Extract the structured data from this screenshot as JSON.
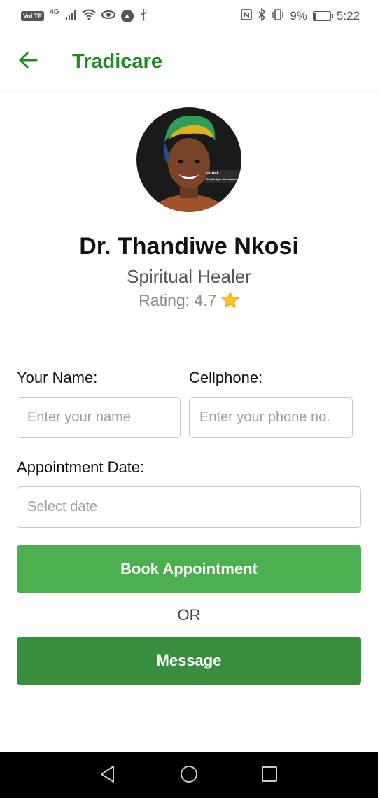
{
  "status_bar": {
    "volte": "VoLTE",
    "network": "4G",
    "battery_percent": "9%",
    "time": "5:22",
    "icons": [
      "volte-icon",
      "signal-icon",
      "wifi-icon",
      "eye-icon",
      "app-icon",
      "usb-icon",
      "nfc-icon",
      "bluetooth-icon",
      "vibrate-icon",
      "battery-icon"
    ]
  },
  "app_bar": {
    "title": "Tradicare",
    "back_icon": "arrow-left-icon",
    "accent_color": "#1f8a1f"
  },
  "profile": {
    "name": "Dr. Thandiwe Nkosi",
    "specialty": "Spiritual Healer",
    "rating_text": "Rating: 4.7",
    "rating_value": 4.7,
    "rating_icon": "star-icon",
    "avatar_watermark_line1": "iStock",
    "avatar_watermark_line2": "Credit: Igor Alecsander"
  },
  "form": {
    "name_label": "Your Name:",
    "name_placeholder": "Enter your name",
    "name_value": "",
    "phone_label": "Cellphone:",
    "phone_placeholder": "Enter your phone no.",
    "phone_value": "",
    "date_label": "Appointment Date:",
    "date_placeholder": "Select date",
    "date_value": ""
  },
  "actions": {
    "book_label": "Book Appointment",
    "book_color": "#4caf50",
    "or_text": "OR",
    "message_label": "Message",
    "message_color": "#388e3c"
  },
  "nav_bar": {
    "icons": [
      "back-triangle-icon",
      "home-circle-icon",
      "recents-square-icon"
    ]
  }
}
